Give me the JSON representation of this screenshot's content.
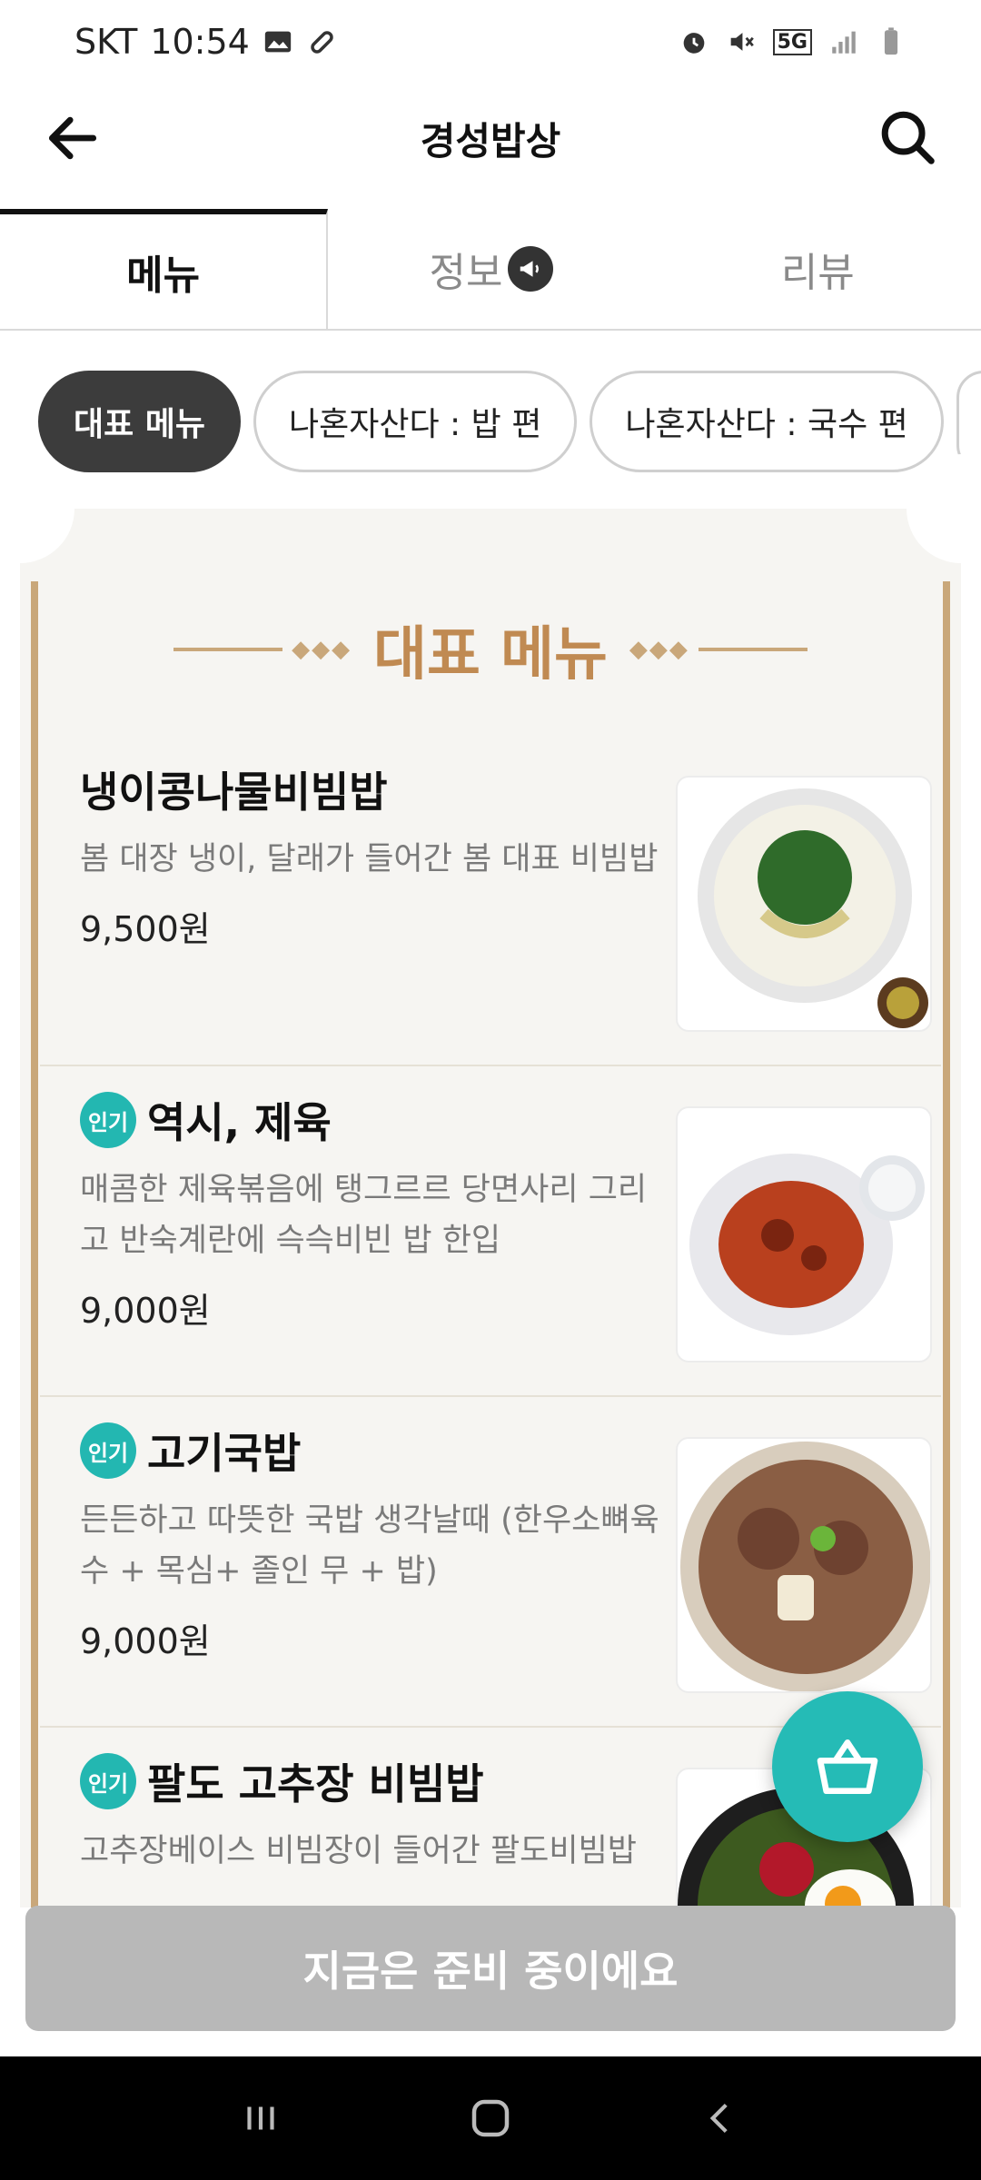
{
  "status_bar": {
    "carrier": "SKT",
    "time": "10:54",
    "left_icons": [
      "image-icon",
      "pill-icon"
    ],
    "right_icons": [
      "alarm-icon",
      "mute-icon",
      "5g-icon",
      "signal-icon",
      "battery-icon"
    ],
    "network_label": "5G"
  },
  "app_bar": {
    "title": "경성밥상",
    "back_icon": "arrow-left-icon",
    "search_icon": "search-icon"
  },
  "tabs": [
    {
      "label": "메뉴",
      "active": true
    },
    {
      "label": "정보",
      "active": false,
      "badge_icon": "megaphone-icon"
    },
    {
      "label": "리뷰",
      "active": false
    }
  ],
  "chips": [
    {
      "label": "대표 메뉴",
      "active": true
    },
    {
      "label": "나혼자산다 : 밥 편",
      "active": false
    },
    {
      "label": "나혼자산다 : 국수 편",
      "active": false
    }
  ],
  "menu_card": {
    "title": "대표 메뉴",
    "items": [
      {
        "popular": false,
        "name": "냉이콩나물비빔밥",
        "desc": "봄 대장 냉이, 달래가 들어간 봄 대표 비빔밥",
        "price": "9,500원",
        "image": "bibimbap-bowl"
      },
      {
        "popular": true,
        "badge": "인기",
        "name": "역시, 제육",
        "desc": "매콤한 제육볶음에 탱그르르 당면사리 그리고 반숙계란에 슥슥비빈 밥 한입",
        "price": "9,000원",
        "image": "jeyuk-plate"
      },
      {
        "popular": true,
        "badge": "인기",
        "name": "고기국밥",
        "desc": "든든하고 따뜻한 국밥 생각날때 (한우소뼈육수 + 목심+ 졸인 무 + 밥)",
        "price": "9,000원",
        "image": "gukbap-bowl"
      },
      {
        "popular": true,
        "badge": "인기",
        "name": "팔도 고추장 비빔밥",
        "desc": "고추장베이스 비빔장이 들어간 팔도비빔밥",
        "price": "",
        "image": "stone-bibimbap"
      }
    ]
  },
  "cart_button": {
    "icon": "basket-icon"
  },
  "bottom_bar": {
    "label": "지금은 준비 중이에요"
  },
  "nav_bar": {
    "icons": [
      "recent-apps-icon",
      "home-icon",
      "back-icon"
    ]
  },
  "colors": {
    "accent": "#25bbb6",
    "title_gold": "#c08a52",
    "frame": "#c9a77a",
    "disabled": "#b8b8b8"
  }
}
